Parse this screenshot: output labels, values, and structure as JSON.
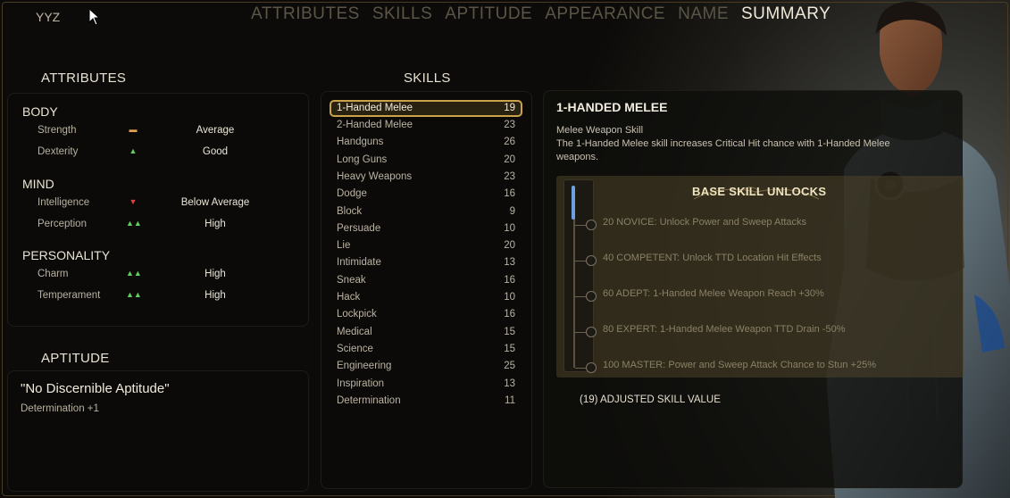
{
  "header": {
    "user": "YYZ",
    "tabs": [
      {
        "label": "ATTRIBUTES",
        "active": false
      },
      {
        "label": "SKILLS",
        "active": false
      },
      {
        "label": "APTITUDE",
        "active": false
      },
      {
        "label": "APPEARANCE",
        "active": false
      },
      {
        "label": "NAME",
        "active": false
      },
      {
        "label": "SUMMARY",
        "active": true
      }
    ]
  },
  "attributes": {
    "title": "ATTRIBUTES",
    "groups": [
      {
        "name": "BODY",
        "items": [
          {
            "name": "Strength",
            "value": "Average",
            "indicator": "average"
          },
          {
            "name": "Dexterity",
            "value": "Good",
            "indicator": "up-1"
          }
        ]
      },
      {
        "name": "MIND",
        "items": [
          {
            "name": "Intelligence",
            "value": "Below Average",
            "indicator": "down-1"
          },
          {
            "name": "Perception",
            "value": "High",
            "indicator": "up-2"
          }
        ]
      },
      {
        "name": "PERSONALITY",
        "items": [
          {
            "name": "Charm",
            "value": "High",
            "indicator": "up-2"
          },
          {
            "name": "Temperament",
            "value": "High",
            "indicator": "up-2"
          }
        ]
      }
    ]
  },
  "aptitude": {
    "title": "APTITUDE",
    "name": "\"No Discernible Aptitude\"",
    "bonus": "Determination +1"
  },
  "skills": {
    "title": "SKILLS",
    "selected_index": 0,
    "items": [
      {
        "name": "1-Handed Melee",
        "value": "19"
      },
      {
        "name": "2-Handed Melee",
        "value": "23"
      },
      {
        "name": "Handguns",
        "value": "26"
      },
      {
        "name": "Long Guns",
        "value": "20"
      },
      {
        "name": "Heavy Weapons",
        "value": "23"
      },
      {
        "name": "Dodge",
        "value": "16"
      },
      {
        "name": "Block",
        "value": "9"
      },
      {
        "name": "Persuade",
        "value": "10"
      },
      {
        "name": "Lie",
        "value": "20"
      },
      {
        "name": "Intimidate",
        "value": "13"
      },
      {
        "name": "Sneak",
        "value": "16"
      },
      {
        "name": "Hack",
        "value": "10"
      },
      {
        "name": "Lockpick",
        "value": "16"
      },
      {
        "name": "Medical",
        "value": "15"
      },
      {
        "name": "Science",
        "value": "15"
      },
      {
        "name": "Engineering",
        "value": "25"
      },
      {
        "name": "Inspiration",
        "value": "13"
      },
      {
        "name": "Determination",
        "value": "11"
      }
    ]
  },
  "detail": {
    "title": "1-HANDED MELEE",
    "subtitle": "Melee Weapon Skill",
    "description": "The 1-Handed Melee skill increases Critical Hit chance with 1-Handed Melee weapons.",
    "unlocks_title": "BASE SKILL UNLOCKS",
    "unlocks": [
      "20 NOVICE: Unlock Power and Sweep Attacks",
      "40 COMPETENT: Unlock TTD Location Hit Effects",
      "60 ADEPT: 1-Handed Melee Weapon Reach +30%",
      "80 EXPERT: 1-Handed Melee Weapon TTD Drain -50%",
      "100 MASTER: Power and Sweep Attack Chance to Stun +25%"
    ],
    "progress_fraction": 0.19,
    "adjusted": "(19) ADJUSTED SKILL VALUE"
  },
  "colors": {
    "accent_gold": "#c9a24a",
    "progress_blue": "#6ea0e0",
    "indicator_up": "#5fd060",
    "indicator_down": "#e04040",
    "indicator_average": "#e0a050"
  }
}
